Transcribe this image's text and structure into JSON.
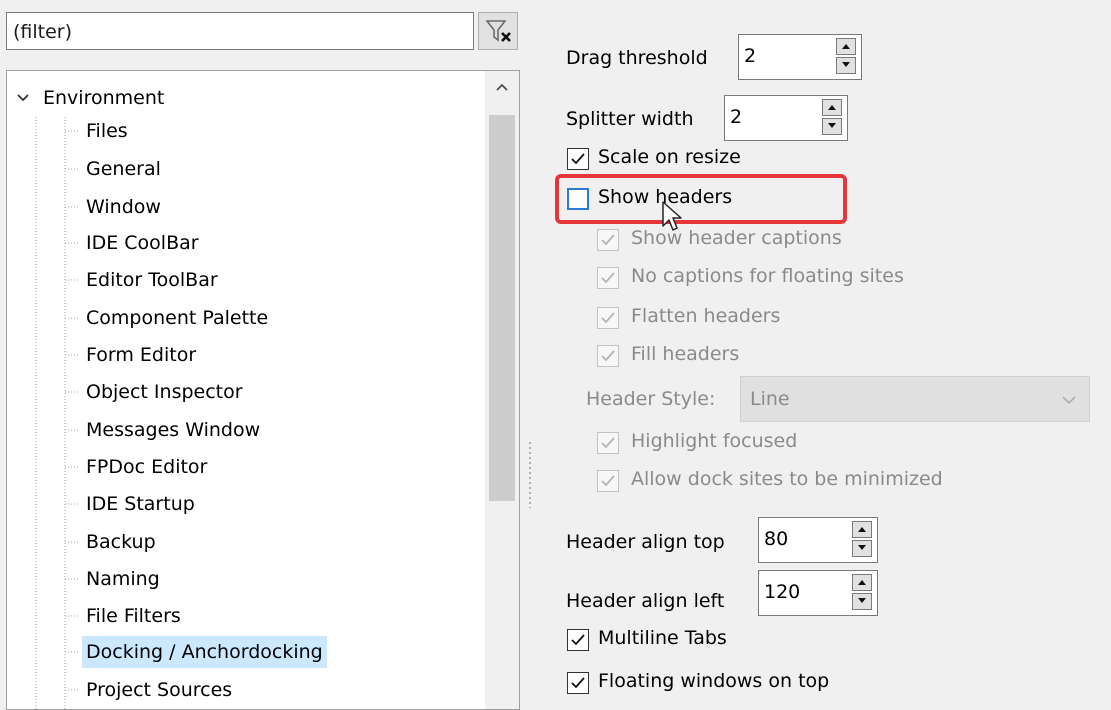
{
  "filter": {
    "placeholder": "(filter)",
    "clear_icon": "filter-clear-icon"
  },
  "tree": {
    "root": "Environment",
    "items": [
      "Files",
      "General",
      "Window",
      "IDE CoolBar",
      "Editor ToolBar",
      "Component Palette",
      "Form Editor",
      "Object Inspector",
      "Messages Window",
      "FPDoc Editor",
      "IDE Startup",
      "Backup",
      "Naming",
      "File Filters",
      "Docking / Anchordocking",
      "Project Sources"
    ],
    "selected": "Docking / Anchordocking"
  },
  "settings": {
    "drag_threshold": {
      "label": "Drag threshold",
      "value": "2"
    },
    "splitter_width": {
      "label": "Splitter width",
      "value": "2"
    },
    "scale_on_resize": {
      "label": "Scale on resize",
      "checked": true
    },
    "show_headers": {
      "label": "Show headers",
      "checked": false
    },
    "show_header_captions": {
      "label": "Show header captions",
      "checked": true,
      "enabled": false
    },
    "no_captions_floating": {
      "label": "No captions for floating sites",
      "checked": true,
      "enabled": false
    },
    "flatten_headers": {
      "label": "Flatten headers",
      "checked": true,
      "enabled": false
    },
    "fill_headers": {
      "label": "Fill headers",
      "checked": true,
      "enabled": false
    },
    "header_style": {
      "label": "Header Style:",
      "value": "Line",
      "enabled": false
    },
    "highlight_focused": {
      "label": "Highlight focused",
      "checked": true,
      "enabled": false
    },
    "allow_minimize": {
      "label": "Allow dock sites to be minimized",
      "checked": true,
      "enabled": false
    },
    "header_align_top": {
      "label": "Header align top",
      "value": "80"
    },
    "header_align_left": {
      "label": "Header align left",
      "value": "120"
    },
    "multiline_tabs": {
      "label": "Multiline Tabs",
      "checked": true
    },
    "floating_windows_on_top": {
      "label": "Floating windows on top",
      "checked": true
    }
  },
  "colors": {
    "highlight": "#e7353c",
    "selection": "#cce8ff",
    "focus_border": "#2b7ad6"
  }
}
